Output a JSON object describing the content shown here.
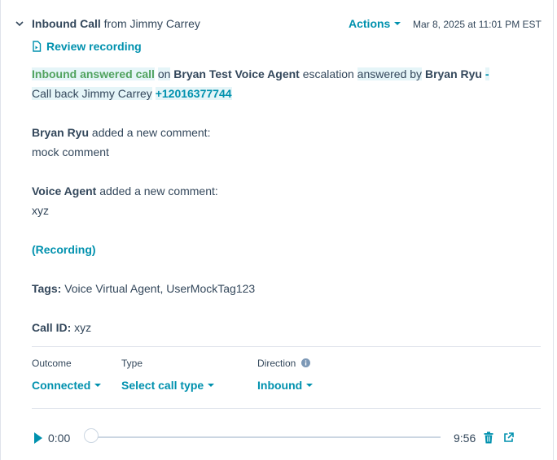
{
  "header": {
    "title_bold": "Inbound Call",
    "title_rest": "from Jimmy Carrey",
    "actions_label": "Actions",
    "timestamp": "Mar 8, 2025 at 11:01 PM EST"
  },
  "review_recording_label": "Review recording",
  "summary": {
    "call_state": "Inbound answered call",
    "on": "on",
    "agent": "Bryan Test Voice Agent",
    "escalation": "escalation",
    "answered_by": "answered by",
    "answerer": "Bryan Ryu",
    "dash": "-",
    "callback_text": "Call back Jimmy Carrey",
    "phone": "+12016377744"
  },
  "comments": [
    {
      "author": "Bryan Ryu",
      "action": "added a new comment:",
      "text": "mock comment"
    },
    {
      "author": "Voice Agent",
      "action": "added a new comment:",
      "text": "xyz"
    }
  ],
  "recording_link": "(Recording)",
  "tags": {
    "label": "Tags:",
    "value": "Voice Virtual Agent, UserMockTag123"
  },
  "call_id": {
    "label": "Call ID:",
    "value": "xyz"
  },
  "fields": {
    "outcome": {
      "label": "Outcome",
      "value": "Connected"
    },
    "type": {
      "label": "Type",
      "value": "Select call type"
    },
    "direction": {
      "label": "Direction",
      "value": "Inbound"
    }
  },
  "player": {
    "current_time": "0:00",
    "duration": "9:56",
    "progress": 0
  },
  "colors": {
    "accent": "#0091ae",
    "green": "#51a35f",
    "text": "#33475b",
    "highlight": "#e5f5f8"
  }
}
